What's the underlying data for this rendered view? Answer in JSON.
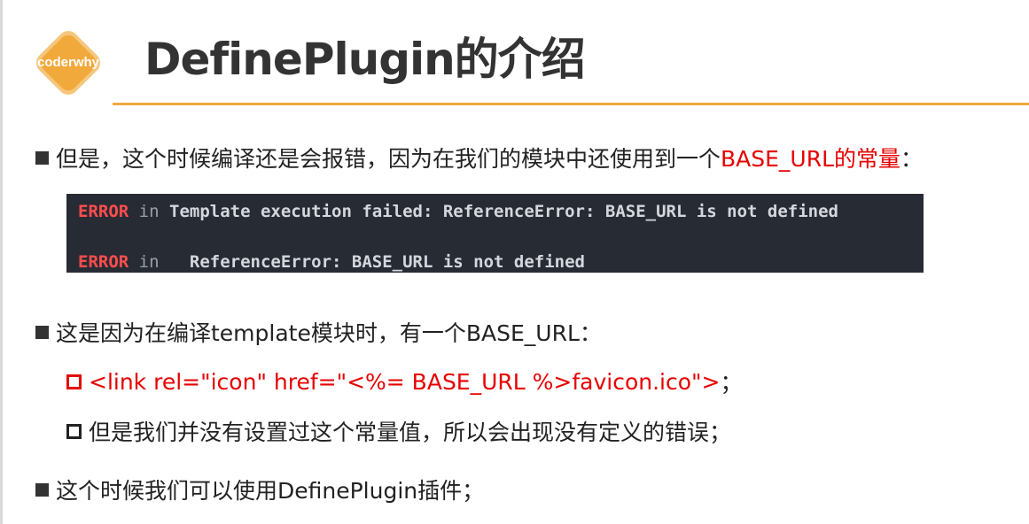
{
  "logo": {
    "text": "coderwhy",
    "color": "#f2a93b"
  },
  "title": "DefinePlugin的介绍",
  "accent_color": "#f2a93b",
  "bullet1": {
    "text_a": "但是，这个时候编译还是会报错，因为在我们的模块中还使用到一个",
    "text_red": "BASE_URL的常量",
    "text_b": "："
  },
  "code": {
    "line1": {
      "error": "ERROR",
      "in": "in",
      "message": "Template execution failed: ReferenceError: BASE_URL is not defined"
    },
    "line2": {
      "error": "ERROR",
      "in": "in",
      "message": "ReferenceError: BASE_URL is not defined"
    }
  },
  "bullet2": {
    "text": "这是因为在编译template模块时，有一个BASE_URL："
  },
  "sub1": {
    "text_red": "<link rel=\"icon\" href=\"<%= BASE_URL %>favicon.ico\">",
    "text_b": "；"
  },
  "sub2": {
    "text": "但是我们并没有设置过这个常量值，所以会出现没有定义的错误；"
  },
  "bullet3": {
    "text": "这个时候我们可以使用DefinePlugin插件；"
  }
}
